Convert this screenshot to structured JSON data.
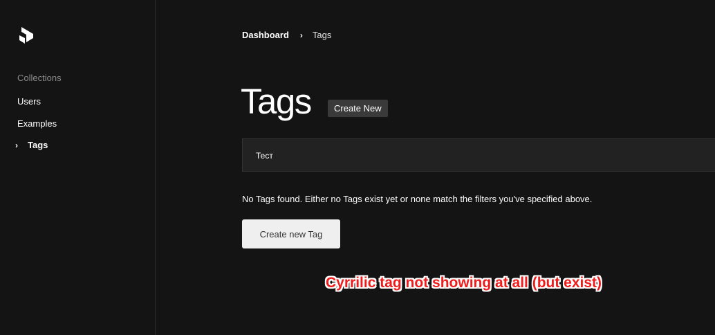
{
  "sidebar": {
    "logo_icon": "payload-logo-icon",
    "heading": "Collections",
    "items": [
      {
        "label": "Users",
        "active": false
      },
      {
        "label": "Examples",
        "active": false
      },
      {
        "label": "Tags",
        "active": true
      }
    ]
  },
  "breadcrumb": {
    "root": "Dashboard",
    "separator_icon": "chevron-right-icon",
    "current": "Tags"
  },
  "main": {
    "title": "Tags",
    "create_new_label": "Create New",
    "filter_value": "Тест",
    "empty_message": "No Tags found. Either no Tags exist yet or none match the filters you've specified above.",
    "create_tag_button": "Create new Tag"
  },
  "annotation": {
    "text": "Cyrrilic tag not showing at all (but exist)",
    "color": "#ee1c1c"
  },
  "colors": {
    "background": "#141414",
    "panel": "#222222",
    "button_light": "#efefef"
  }
}
